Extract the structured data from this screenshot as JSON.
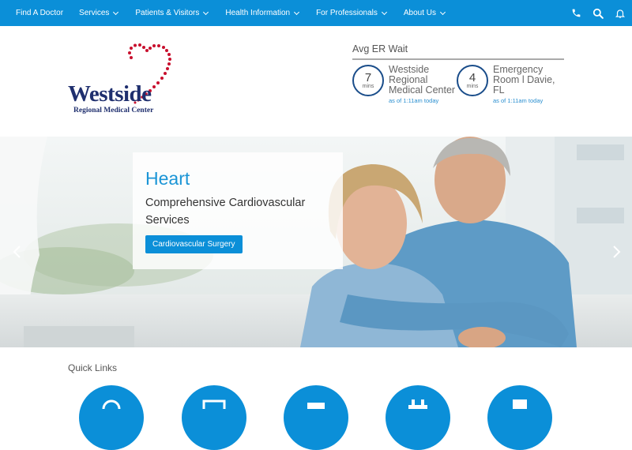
{
  "nav": {
    "items": [
      {
        "label": "Find A Doctor",
        "has_dropdown": false
      },
      {
        "label": "Services",
        "has_dropdown": true
      },
      {
        "label": "Patients & Visitors",
        "has_dropdown": true
      },
      {
        "label": "Health Information",
        "has_dropdown": true
      },
      {
        "label": "For Professionals",
        "has_dropdown": true
      },
      {
        "label": "About Us",
        "has_dropdown": true
      }
    ],
    "icons": [
      "phone-icon",
      "search-icon",
      "bell-icon"
    ],
    "background": "#0b8fd8"
  },
  "logo": {
    "name": "Westside",
    "subtitle": "Regional Medical Center"
  },
  "er_wait": {
    "title": "Avg ER Wait",
    "locations": [
      {
        "minutes": "7",
        "unit": "mins",
        "name": "Westside Regional Medical Center",
        "time": "as of 1:11am today"
      },
      {
        "minutes": "4",
        "unit": "mins",
        "name": "Emergency Room l Davie, FL",
        "time": "as of 1:11am today"
      }
    ]
  },
  "hero": {
    "title": "Heart",
    "subtitle": "Comprehensive Cardiovascular Services",
    "button": "Cardiovascular Surgery",
    "prev_icon": "chevron-left-icon",
    "next_icon": "chevron-right-icon"
  },
  "quick_links": {
    "title": "Quick Links"
  },
  "colors": {
    "accent": "#0b8fd8",
    "logo_navy": "#1f2f6e",
    "logo_heart": "#c8102e"
  }
}
